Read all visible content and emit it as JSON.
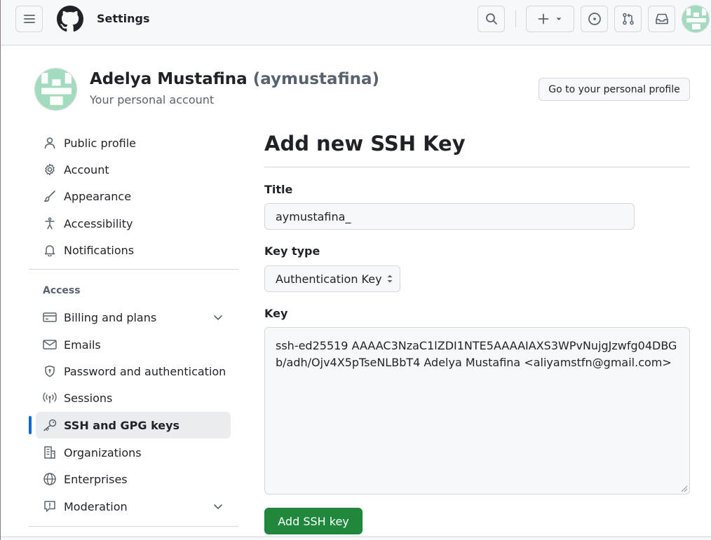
{
  "header": {
    "context_title": "Settings"
  },
  "account": {
    "name": "Adelya Mustafina",
    "login": "(aymustafina)",
    "subtitle": "Your personal account",
    "profile_button": "Go to your personal profile"
  },
  "sidebar": {
    "access_heading": "Access",
    "items": [
      {
        "label": "Public profile",
        "icon": "person-icon"
      },
      {
        "label": "Account",
        "icon": "gear-icon"
      },
      {
        "label": "Appearance",
        "icon": "paintbrush-icon"
      },
      {
        "label": "Accessibility",
        "icon": "accessibility-icon"
      },
      {
        "label": "Notifications",
        "icon": "bell-icon"
      },
      {
        "label": "Billing and plans",
        "icon": "credit-card-icon",
        "expandable": true
      },
      {
        "label": "Emails",
        "icon": "mail-icon"
      },
      {
        "label": "Password and authentication",
        "icon": "shield-lock-icon"
      },
      {
        "label": "Sessions",
        "icon": "broadcast-icon"
      },
      {
        "label": "SSH and GPG keys",
        "icon": "key-icon",
        "active": true
      },
      {
        "label": "Organizations",
        "icon": "organization-icon"
      },
      {
        "label": "Enterprises",
        "icon": "globe-icon"
      },
      {
        "label": "Moderation",
        "icon": "report-icon",
        "expandable": true
      }
    ]
  },
  "form": {
    "heading": "Add new SSH Key",
    "title_label": "Title",
    "title_value": "aymustafina_",
    "key_type_label": "Key type",
    "key_type_value": "Authentication Key",
    "key_label": "Key",
    "key_value": "ssh-ed25519 AAAAC3NzaC1lZDI1NTE5AAAAIAXS3WPvNujgJzwfg04DBGb/adh/Ojv4X5pTseNLBbT4 Adelya Mustafina <aliyamstfn@gmail.com>",
    "submit_label": "Add SSH key"
  },
  "colors": {
    "accent": "#0969da",
    "primary_button": "#1f883d",
    "avatar_green": "#a3dbbf"
  }
}
